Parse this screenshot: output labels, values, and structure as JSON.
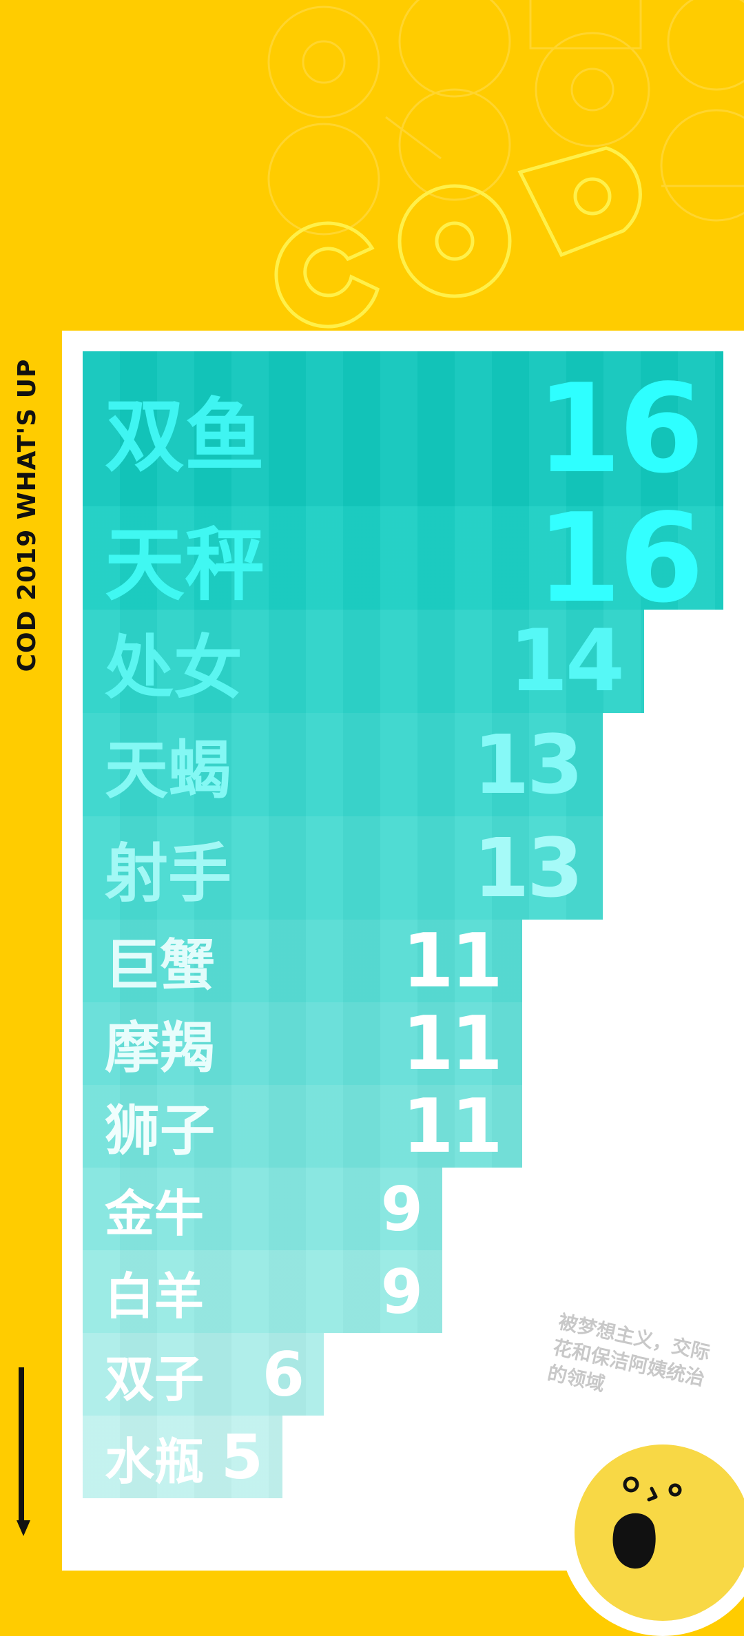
{
  "side_title": "COD 2019 WHAT'S UP",
  "decor": {
    "watermark_text": "COD",
    "background_color": "#FFCC00",
    "outline_color": "#FFE24D"
  },
  "ranking": [
    {
      "sign": "双鱼",
      "count": "16",
      "bg": "#12C7BC",
      "sign_color": "#3FF5F2",
      "num_color": "#2EFFFF"
    },
    {
      "sign": "天秤",
      "count": "16",
      "bg": "#1CCFC4",
      "sign_color": "#40F8F2",
      "num_color": "#33FFFF"
    },
    {
      "sign": "处女",
      "count": "14",
      "bg": "#2DD3C9",
      "sign_color": "#5BF5F0",
      "num_color": "#56F8F6"
    },
    {
      "sign": "天蝎",
      "count": "13",
      "bg": "#3AD6CD",
      "sign_color": "#84F8F4",
      "num_color": "#86F9F7"
    },
    {
      "sign": "射手",
      "count": "13",
      "bg": "#48DAD1",
      "sign_color": "#A3F8F5",
      "num_color": "#A6FAF8"
    },
    {
      "sign": "巨蟹",
      "count": "11",
      "bg": "#57DCD4",
      "sign_color": "#E2FCFB",
      "num_color": "#FFFFFF"
    },
    {
      "sign": "摩羯",
      "count": "11",
      "bg": "#65DFD8",
      "sign_color": "#E8FDFC",
      "num_color": "#FFFFFF"
    },
    {
      "sign": "狮子",
      "count": "11",
      "bg": "#74E2DB",
      "sign_color": "#F0FEFD",
      "num_color": "#FFFFFF"
    },
    {
      "sign": "金牛",
      "count": "9",
      "bg": "#85E6E0",
      "sign_color": "#FFFFFF",
      "num_color": "#FFFFFF"
    },
    {
      "sign": "白羊",
      "count": "9",
      "bg": "#98EAE4",
      "sign_color": "#FFFFFF",
      "num_color": "#FFFFFF"
    },
    {
      "sign": "双子",
      "count": "6",
      "bg": "#ACEDE9",
      "sign_color": "#FFFFFF",
      "num_color": "#FFFFFF"
    },
    {
      "sign": "水瓶",
      "count": "5",
      "bg": "#C1F2EE",
      "sign_color": "#FFFFFF",
      "num_color": "#FFFFFF"
    }
  ],
  "note": "被梦想主义，交际花和保洁阿姨统治的领域",
  "mascot": {
    "icon": "surprised-face-icon",
    "face_color": "#F8D845"
  }
}
